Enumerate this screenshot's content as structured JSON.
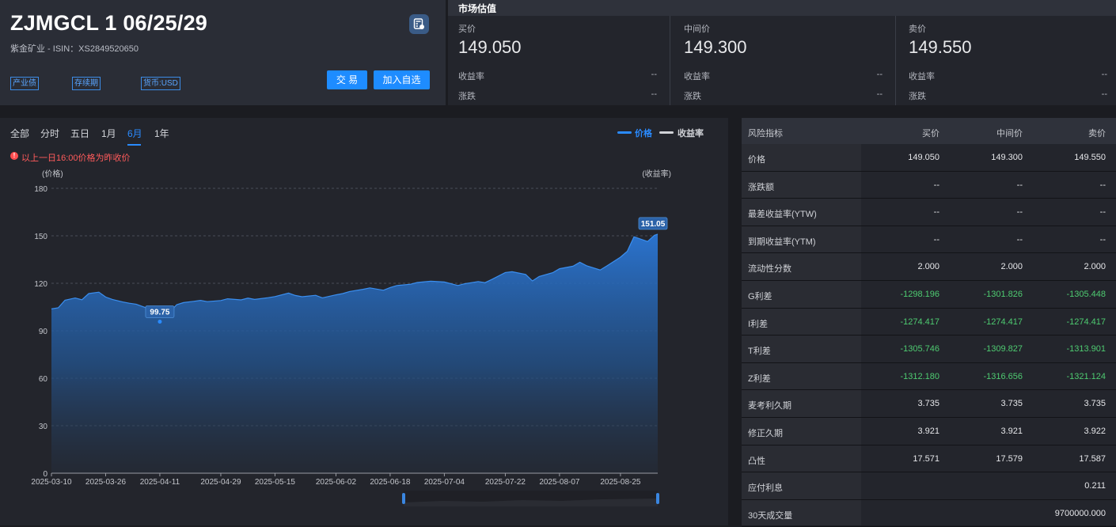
{
  "header": {
    "title": "ZJMGCL 1 06/25/29",
    "subtitle": "紫金矿业 - ISIN：XS2849520650",
    "tags": [
      "产业债",
      "存续期",
      "货币:USD"
    ],
    "trade_label": "交 易",
    "watch_label": "加入自选"
  },
  "market_valuation": {
    "title": "市场估值",
    "columns": [
      {
        "label": "买价",
        "price": "149.050",
        "yield_label": "收益率",
        "yield": "--",
        "change_label": "涨跌",
        "change": "--"
      },
      {
        "label": "中间价",
        "price": "149.300",
        "yield_label": "收益率",
        "yield": "--",
        "change_label": "涨跌",
        "change": "--"
      },
      {
        "label": "卖价",
        "price": "149.550",
        "yield_label": "收益率",
        "yield": "--",
        "change_label": "涨跌",
        "change": "--"
      }
    ]
  },
  "chart_panel": {
    "tabs": [
      "全部",
      "分时",
      "五日",
      "1月",
      "6月",
      "1年"
    ],
    "active_tab": 4,
    "legend": {
      "price": "价格",
      "yield": "收益率"
    },
    "notice": "以上一日16:00价格为昨收价",
    "colors": {
      "accent": "#2a8bff",
      "area_top": "#2b77d6",
      "warning": "#ff5b5b"
    }
  },
  "chart_data": {
    "type": "area",
    "ylabel_left": "(价格)",
    "ylabel_right": "(收益率)",
    "ylim": [
      0,
      180
    ],
    "yticks": [
      0,
      30,
      60,
      90,
      120,
      150,
      180
    ],
    "x_ticks": [
      "2025-03-10",
      "2025-03-26",
      "2025-04-11",
      "2025-04-29",
      "2025-05-15",
      "2025-06-02",
      "2025-06-18",
      "2025-07-04",
      "2025-07-22",
      "2025-08-07",
      "2025-08-25"
    ],
    "grid": true,
    "series": [
      {
        "name": "价格",
        "x": [
          "2025-03-10",
          "2025-03-12",
          "2025-03-14",
          "2025-03-17",
          "2025-03-19",
          "2025-03-21",
          "2025-03-24",
          "2025-03-26",
          "2025-03-28",
          "2025-03-31",
          "2025-04-02",
          "2025-04-04",
          "2025-04-07",
          "2025-04-09",
          "2025-04-11",
          "2025-04-14",
          "2025-04-16",
          "2025-04-18",
          "2025-04-21",
          "2025-04-23",
          "2025-04-25",
          "2025-04-29",
          "2025-05-01",
          "2025-05-05",
          "2025-05-07",
          "2025-05-09",
          "2025-05-13",
          "2025-05-15",
          "2025-05-19",
          "2025-05-21",
          "2025-05-23",
          "2025-05-27",
          "2025-05-29",
          "2025-06-02",
          "2025-06-04",
          "2025-06-06",
          "2025-06-10",
          "2025-06-12",
          "2025-06-16",
          "2025-06-18",
          "2025-06-20",
          "2025-06-24",
          "2025-06-26",
          "2025-06-30",
          "2025-07-04",
          "2025-07-08",
          "2025-07-10",
          "2025-07-14",
          "2025-07-16",
          "2025-07-18",
          "2025-07-22",
          "2025-07-24",
          "2025-07-28",
          "2025-07-30",
          "2025-08-01",
          "2025-08-05",
          "2025-08-07",
          "2025-08-11",
          "2025-08-13",
          "2025-08-15",
          "2025-08-19",
          "2025-08-21",
          "2025-08-25",
          "2025-08-27",
          "2025-08-29",
          "2025-09-02",
          "2025-09-04",
          "2025-09-05"
        ],
        "values": [
          103.8,
          104.5,
          109.3,
          110.7,
          109.6,
          113.5,
          114.4,
          111.3,
          109.8,
          108.2,
          107.4,
          106.8,
          104.5,
          101.5,
          99.75,
          102.0,
          106.5,
          107.8,
          108.6,
          109.2,
          108.4,
          109.1,
          110.2,
          109.5,
          110.6,
          109.8,
          110.9,
          111.6,
          113.8,
          112.3,
          111.5,
          112.4,
          110.8,
          112.7,
          113.5,
          114.8,
          116.2,
          117.1,
          115.6,
          117.3,
          118.6,
          119.4,
          120.5,
          121.3,
          120.8,
          118.6,
          119.7,
          121.1,
          120.4,
          122.4,
          126.8,
          127.3,
          125.6,
          121.5,
          124.3,
          126.7,
          129.2,
          130.8,
          133.3,
          131.1,
          128.4,
          131.0,
          136.5,
          140.2,
          149.4,
          146.4,
          150.3,
          151.05
        ],
        "labels": [
          {
            "x": "2025-04-11",
            "text": "99.75"
          },
          {
            "x": "2025-09-05",
            "text": "151.05"
          }
        ]
      }
    ]
  },
  "risk_table": {
    "headers": [
      "风险指标",
      "买价",
      "中间价",
      "卖价"
    ],
    "rows": [
      {
        "label": "价格",
        "bid": "149.050",
        "mid": "149.300",
        "ask": "149.550",
        "tone": "normal"
      },
      {
        "label": "涨跌额",
        "bid": "--",
        "mid": "--",
        "ask": "--",
        "tone": "normal"
      },
      {
        "label": "最差收益率(YTW)",
        "bid": "--",
        "mid": "--",
        "ask": "--",
        "tone": "normal"
      },
      {
        "label": "到期收益率(YTM)",
        "bid": "--",
        "mid": "--",
        "ask": "--",
        "tone": "normal"
      },
      {
        "label": "流动性分数",
        "bid": "2.000",
        "mid": "2.000",
        "ask": "2.000",
        "tone": "normal"
      },
      {
        "label": "G利差",
        "bid": "-1298.196",
        "mid": "-1301.826",
        "ask": "-1305.448",
        "tone": "green"
      },
      {
        "label": "I利差",
        "bid": "-1274.417",
        "mid": "-1274.417",
        "ask": "-1274.417",
        "tone": "green"
      },
      {
        "label": "T利差",
        "bid": "-1305.746",
        "mid": "-1309.827",
        "ask": "-1313.901",
        "tone": "green"
      },
      {
        "label": "Z利差",
        "bid": "-1312.180",
        "mid": "-1316.656",
        "ask": "-1321.124",
        "tone": "green"
      },
      {
        "label": "麦考利久期",
        "bid": "3.735",
        "mid": "3.735",
        "ask": "3.735",
        "tone": "normal"
      },
      {
        "label": "修正久期",
        "bid": "3.921",
        "mid": "3.921",
        "ask": "3.922",
        "tone": "normal"
      },
      {
        "label": "凸性",
        "bid": "17.571",
        "mid": "17.579",
        "ask": "17.587",
        "tone": "normal"
      },
      {
        "label": "应付利息",
        "bid": "",
        "mid": "",
        "ask": "0.211",
        "tone": "normal"
      },
      {
        "label": "30天成交量",
        "bid": "",
        "mid": "",
        "ask": "9700000.000",
        "tone": "normal"
      }
    ],
    "colors": {
      "green": "#4ecb71",
      "normal": "#e6e7ea"
    }
  }
}
